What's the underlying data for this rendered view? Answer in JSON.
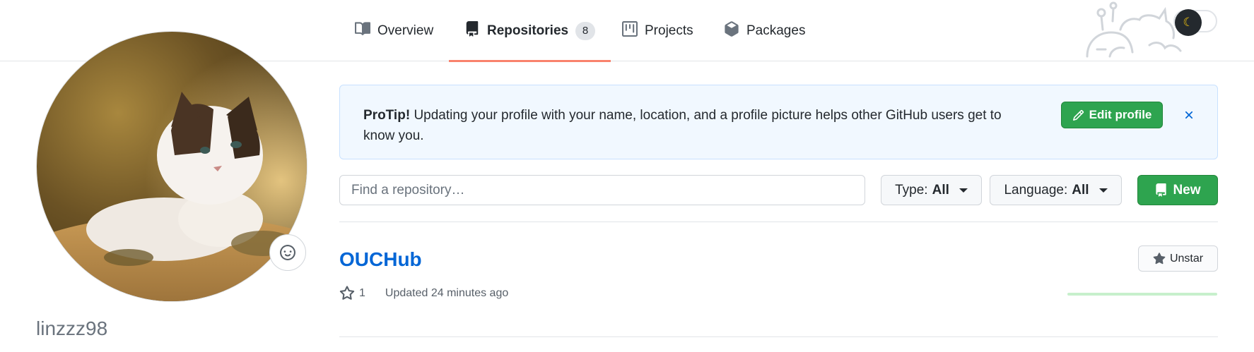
{
  "nav": {
    "tabs": [
      {
        "label": "Overview",
        "icon": "book-icon"
      },
      {
        "label": "Repositories",
        "icon": "repo-icon",
        "count": "8",
        "selected": true
      },
      {
        "label": "Projects",
        "icon": "project-icon"
      },
      {
        "label": "Packages",
        "icon": "package-icon"
      }
    ]
  },
  "theme": {
    "icon": "moon-icon"
  },
  "profile": {
    "username": "linzzz98",
    "emoji_icon": "smiley-icon"
  },
  "protip": {
    "title": "ProTip!",
    "message": "Updating your profile with your name, location, and a profile picture helps other GitHub users get to know you.",
    "edit_label": "Edit profile"
  },
  "filters": {
    "search_placeholder": "Find a repository…",
    "type_label": "Type:",
    "type_value": "All",
    "language_label": "Language:",
    "language_value": "All",
    "new_label": "New"
  },
  "repositories": [
    {
      "name": "OUCHub",
      "stars": "1",
      "updated": "Updated 24 minutes ago",
      "star_button": "Unstar"
    }
  ],
  "colors": {
    "accent": "#2ea44f",
    "link": "#0366d6",
    "tab_underline": "#f9826c"
  }
}
